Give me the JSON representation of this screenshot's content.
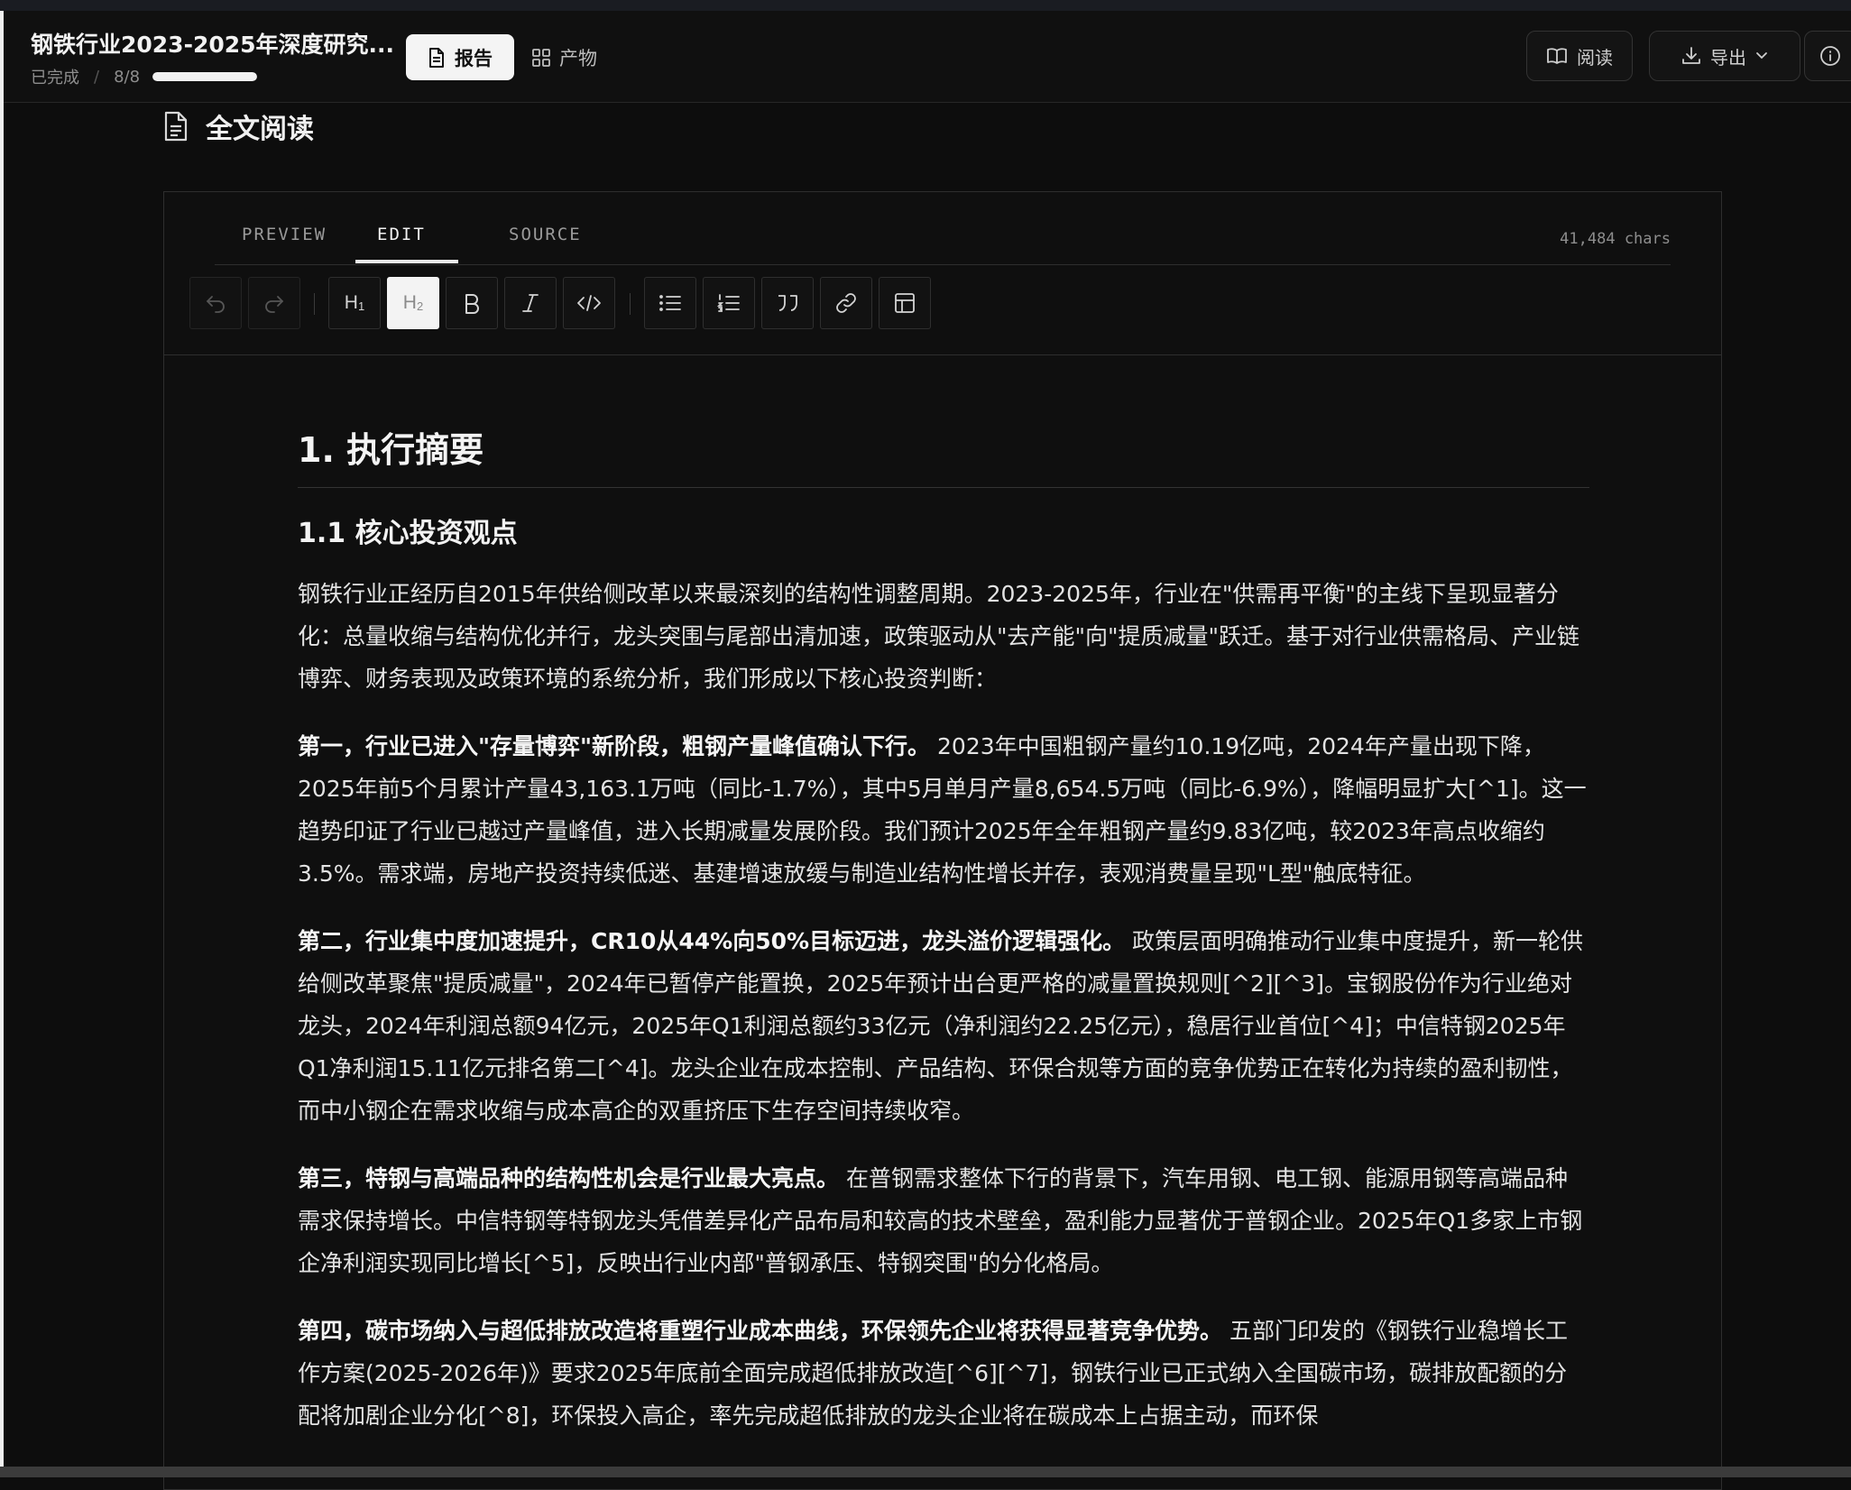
{
  "header": {
    "title": "钢铁行业2023-2025年深度研究...",
    "status": "已完成",
    "separator": "/",
    "progress_text": "8/8",
    "progress_fraction": 1.0,
    "tab_report": "报告",
    "tab_artifacts": "产物",
    "read_button": "阅读",
    "export_button": "导出"
  },
  "section": {
    "title": "全文阅读"
  },
  "editor": {
    "tabs": [
      "PREVIEW",
      "EDIT",
      "SOURCE"
    ],
    "active_tab": "EDIT",
    "char_count": "41,484 chars",
    "toolbar": {
      "h1": "H",
      "h1_sub": "1",
      "h2": "H",
      "h2_sub": "2",
      "active": "h2"
    }
  },
  "document": {
    "h1": "1. 执行摘要",
    "h2": "1.1 核心投资观点",
    "intro": "钢铁行业正经历自2015年供给侧改革以来最深刻的结构性调整周期。2023-2025年，行业在\"供需再平衡\"的主线下呈现显著分化：总量收缩与结构优化并行，龙头突围与尾部出清加速，政策驱动从\"去产能\"向\"提质减量\"跃迁。基于对行业供需格局、产业链博弈、财务表现及政策环境的系统分析，我们形成以下核心投资判断：",
    "points": [
      {
        "lead": "第一，行业已进入\"存量博弈\"新阶段，粗钢产量峰值确认下行。",
        "body": " 2023年中国粗钢产量约10.19亿吨，2024年产量出现下降，2025年前5个月累计产量43,163.1万吨（同比-1.7%），其中5月单月产量8,654.5万吨（同比-6.9%），降幅明显扩大[^1]。这一趋势印证了行业已越过产量峰值，进入长期减量发展阶段。我们预计2025年全年粗钢产量约9.83亿吨，较2023年高点收缩约3.5%。需求端，房地产投资持续低迷、基建增速放缓与制造业结构性增长并存，表观消费量呈现\"L型\"触底特征。"
      },
      {
        "lead": "第二，行业集中度加速提升，CR10从44%向50%目标迈进，龙头溢价逻辑强化。",
        "body": " 政策层面明确推动行业集中度提升，新一轮供给侧改革聚焦\"提质减量\"，2024年已暂停产能置换，2025年预计出台更严格的减量置换规则[^2][^3]。宝钢股份作为行业绝对龙头，2024年利润总额94亿元，2025年Q1利润总额约33亿元（净利润约22.25亿元），稳居行业首位[^4]；中信特钢2025年Q1净利润15.11亿元排名第二[^4]。龙头企业在成本控制、产品结构、环保合规等方面的竞争优势正在转化为持续的盈利韧性，而中小钢企在需求收缩与成本高企的双重挤压下生存空间持续收窄。"
      },
      {
        "lead": "第三，特钢与高端品种的结构性机会是行业最大亮点。",
        "body": " 在普钢需求整体下行的背景下，汽车用钢、电工钢、能源用钢等高端品种需求保持增长。中信特钢等特钢龙头凭借差异化产品布局和较高的技术壁垒，盈利能力显著优于普钢企业。2025年Q1多家上市钢企净利润实现同比增长[^5]，反映出行业内部\"普钢承压、特钢突围\"的分化格局。"
      },
      {
        "lead": "第四，碳市场纳入与超低排放改造将重塑行业成本曲线，环保领先企业将获得显著竞争优势。",
        "body": " 五部门印发的《钢铁行业稳增长工作方案(2025-2026年)》要求2025年底前全面完成超低排放改造[^6][^7]，钢铁行业已正式纳入全国碳市场，碳排放配额的分配将加剧企业分化[^8]，环保投入高企，率先完成超低排放的龙头企业将在碳成本上占据主动，而环保"
      }
    ]
  }
}
